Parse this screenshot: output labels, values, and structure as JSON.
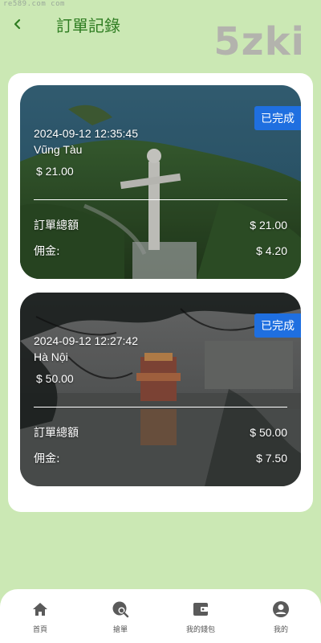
{
  "watermark": {
    "top_text": "re589.com  com",
    "big_text": "5zki"
  },
  "header": {
    "back_icon": "chevron-left-icon",
    "title": "訂單記錄"
  },
  "colors": {
    "background": "#cbe8b4",
    "title": "#2f7d22",
    "badge": "#1f6fe0",
    "nav_icon": "#5a5a5a"
  },
  "orders": [
    {
      "status": "已完成",
      "datetime": "2024-09-12 12:35:45",
      "destination": "Vũng Tàu",
      "price": "$ 21.00",
      "total_label": "訂單總額",
      "total_value": "$ 21.00",
      "commission_label": "佣金:",
      "commission_value": "$ 4.20"
    },
    {
      "status": "已完成",
      "datetime": "2024-09-12 12:27:42",
      "destination": "Hà Nội",
      "price": "$ 50.00",
      "total_label": "訂單總額",
      "total_value": "$ 50.00",
      "commission_label": "佣金:",
      "commission_value": "$ 7.50"
    }
  ],
  "nav": [
    {
      "label": "首頁",
      "icon": "home-icon"
    },
    {
      "label": "搶單",
      "icon": "search-globe-icon"
    },
    {
      "label": "我的錢包",
      "icon": "wallet-icon"
    },
    {
      "label": "我的",
      "icon": "user-icon"
    }
  ]
}
